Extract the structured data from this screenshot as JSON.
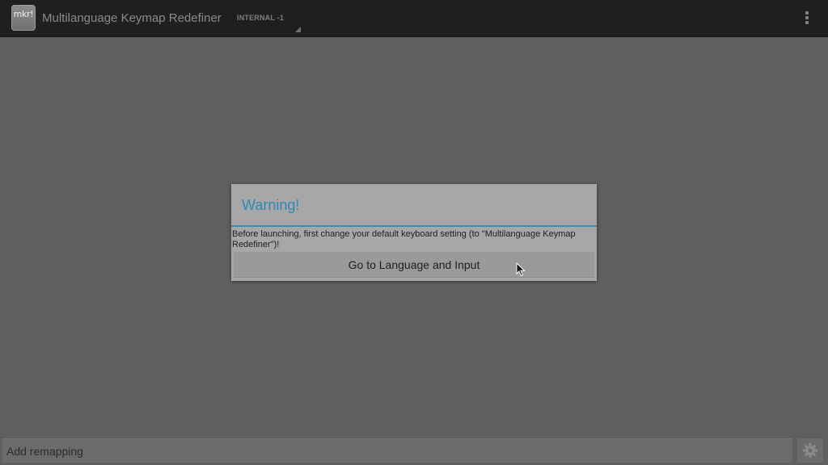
{
  "actionbar": {
    "app_icon_text": "mkr!",
    "app_title": "Multilanguage Keymap Redefiner",
    "spinner_value": "INTERNAL -1",
    "overflow_icon": "more-vertical-icon"
  },
  "dialog": {
    "title": "Warning!",
    "message": "Before launching, first change your default keyboard setting (to \"Multilanguage Keymap Redefiner\")!",
    "button_label": "Go to Language and Input"
  },
  "bottom_bar": {
    "input_label": "Add remapping",
    "settings_icon": "gear-icon"
  },
  "colors": {
    "actionbar_bg": "#1f1f1f",
    "content_bg": "#5f5f5f",
    "dialog_bg": "#a7a7a7",
    "accent": "#2f89b7"
  }
}
